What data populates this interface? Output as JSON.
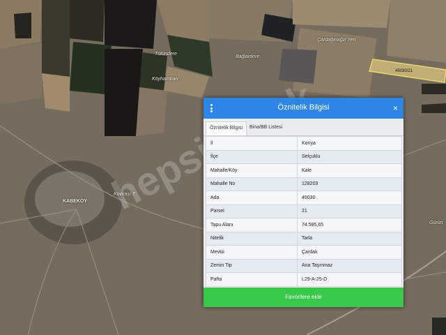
{
  "map": {
    "labels": [
      "Tütündere",
      "Bağlardere",
      "Çardağınağzi Yeri",
      "Kovkaşı T",
      "KABEKÖY",
      "Köyhambarı",
      "Gürün"
    ],
    "parcel_label": "45030/21",
    "watermark": "hepsiemlak"
  },
  "panel": {
    "title": "Öznitelik Bilgisi",
    "menu_icon": "vertical-dots-icon",
    "close_icon": "close-icon",
    "close_symbol": "×",
    "header_color": "#2d86e6",
    "tabs": [
      {
        "label": "Öznitelik Bilgisi",
        "active": true
      },
      {
        "label": "Bina/BB Listesi",
        "active": false
      }
    ],
    "rows": [
      {
        "key": "İl",
        "value": "Konya"
      },
      {
        "key": "İlçe",
        "value": "Selçuklu"
      },
      {
        "key": "Mahalle/Köy",
        "value": "Kale"
      },
      {
        "key": "Mahalle No",
        "value": "128203"
      },
      {
        "key": "Ada",
        "value": "45030"
      },
      {
        "key": "Parsel",
        "value": "21"
      },
      {
        "key": "Tapu Alanı",
        "value": "74.595,65"
      },
      {
        "key": "Nitelik",
        "value": "Tarla"
      },
      {
        "key": "Mevkii",
        "value": "Çardak"
      },
      {
        "key": "Zemin Tip",
        "value": "Ana Taşınmaz"
      },
      {
        "key": "Pafta",
        "value": "L29-A-25-D"
      }
    ],
    "favorite_button": "Favorilere ekle",
    "button_color": "#38c94a"
  }
}
